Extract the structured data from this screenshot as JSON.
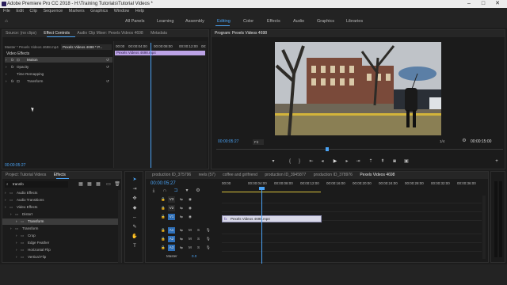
{
  "window": {
    "title": "Adobe Premiere Pro CC 2018 - H:\\Training Tutorials\\Tutorial Videos *",
    "minimize": "–",
    "maximize": "□",
    "close": "✕"
  },
  "menu": [
    "File",
    "Edit",
    "Clip",
    "Sequence",
    "Markers",
    "Graphics",
    "Window",
    "Help"
  ],
  "workspaces": {
    "all_panels": "All Panels",
    "learning": "Learning",
    "assembly": "Assembly",
    "editing": "Editing",
    "color": "Color",
    "effects": "Effects",
    "audio": "Audio",
    "graphics": "Graphics",
    "libraries": "Libraries"
  },
  "source_panel": {
    "tabs": {
      "source": "Source: (no clips)",
      "effect_controls": "Effect Controls",
      "audio_mixer": "Audio Clip Mixer: Pexels Videos 4698",
      "metadata": "Metadata"
    },
    "master": "Master * Pexels Videos 4698.mp4",
    "sequence": "Pexels Videos 4698 * P...",
    "video_effects": "Video Effects",
    "motion": "Motion",
    "opacity": "Opacity",
    "time_remapping": "Time Remapping",
    "transform": "Transform",
    "times": [
      "00:00",
      "00:00:04:00",
      "00:00:08:00",
      "00:00:12:00",
      "00:"
    ],
    "clip_label": "Pexels Videos 4698.mp4",
    "timecode": "00:00:05:27"
  },
  "program_monitor": {
    "title": "Program: Pexels Videos 4698",
    "timecode": "00:00:05:27",
    "fit": "Fit",
    "quarter": "1/4",
    "duration": "00:00:15:00",
    "video_colors": {
      "sky": "#bfc3c8",
      "building": "#7a4a3a",
      "tree": "#2d2b27",
      "ground": "#8a7f54",
      "curb": "#d3b43a"
    }
  },
  "project_panel": {
    "tabs": {
      "project": "Project: Tutorial Videos",
      "effects": "Effects"
    },
    "search": "transfo",
    "tree": [
      {
        "label": "Audio Effects",
        "indent": 0
      },
      {
        "label": "Audio Transitions",
        "indent": 0
      },
      {
        "label": "Video Effects",
        "indent": 0
      },
      {
        "label": "Distort",
        "indent": 1
      },
      {
        "label": "Transform",
        "indent": 2,
        "selected": true
      },
      {
        "label": "Transform",
        "indent": 1
      },
      {
        "label": "Crop",
        "indent": 2
      },
      {
        "label": "Edge Feather",
        "indent": 2
      },
      {
        "label": "Horizontal Flip",
        "indent": 2
      },
      {
        "label": "Vertical Flip",
        "indent": 2
      }
    ]
  },
  "timeline": {
    "tabs": [
      "production ID_375796",
      "reels (57)",
      "coffee and girlfriend",
      "production ID_3945877",
      "production ID_378976",
      "Pexels Videos 4698"
    ],
    "timecode": "00:00:05:27",
    "ruler": [
      "00:00",
      "00:00:04:00",
      "00:00:08:00",
      "00:00:12:00",
      "00:00:16:00",
      "00:00:20:00",
      "00:00:24:00",
      "00:00:28:00",
      "00:00:32:00",
      "00:00:36:00"
    ],
    "video_tracks": [
      "V3",
      "V2",
      "V1"
    ],
    "audio_tracks": [
      "A1",
      "A2",
      "A3"
    ],
    "clip_label": "Pexels Videos 4698.mp4",
    "master_label": "Master",
    "master_value": "0.0",
    "track_buttons": [
      "M",
      "S"
    ]
  }
}
